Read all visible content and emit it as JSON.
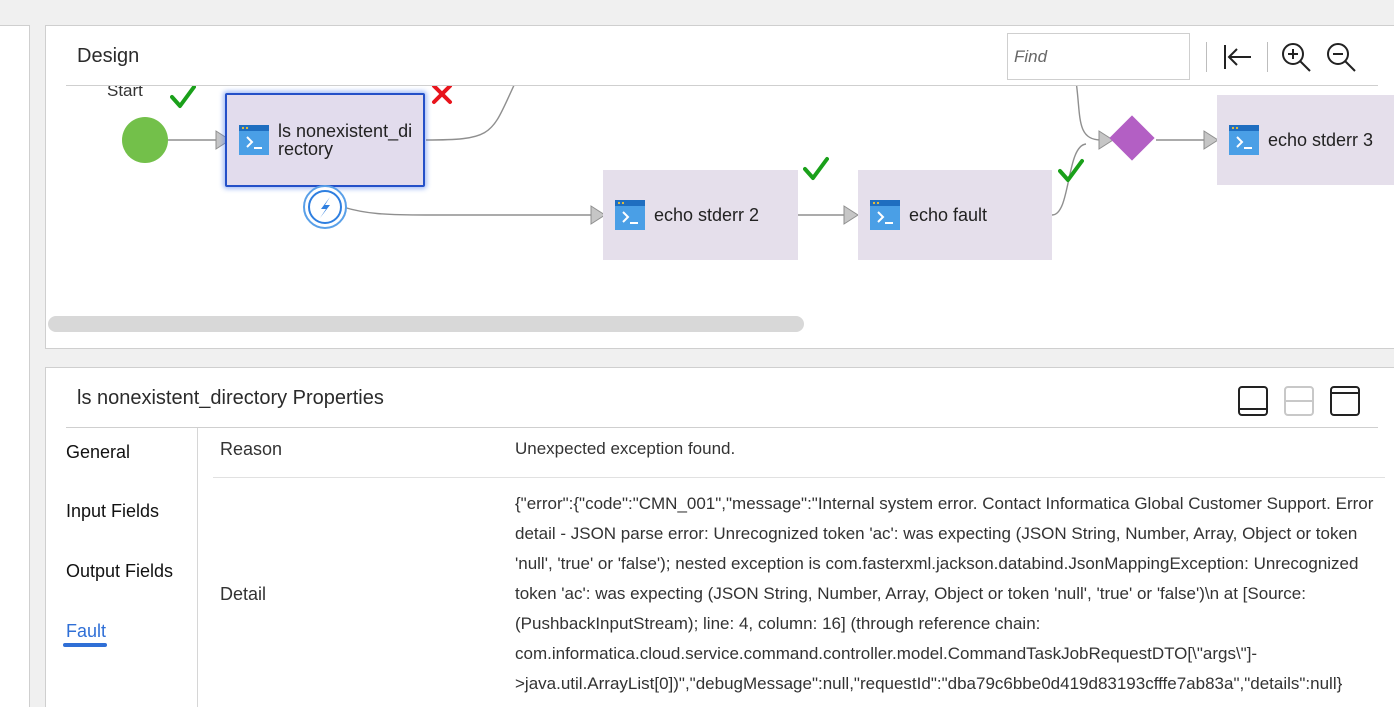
{
  "design": {
    "title": "Design",
    "find_placeholder": "Find",
    "start_label": "Start",
    "nodes": {
      "ls": "ls nonexistent_directory",
      "echo_stderr_2": "echo stderr 2",
      "echo_fault": "echo fault",
      "echo_stderr_3": "echo stderr 3"
    }
  },
  "properties": {
    "title": "ls nonexistent_directory Properties",
    "tabs": [
      "General",
      "Input Fields",
      "Output Fields",
      "Fault"
    ],
    "active_tab": "Fault",
    "reason_label": "Reason",
    "reason_value": "Unexpected exception found.",
    "detail_label": "Detail",
    "detail_value": "{\"error\":{\"code\":\"CMN_001\",\"message\":\"Internal system error. Contact Informatica Global Customer Support. Error detail - JSON parse error: Unrecognized token 'ac': was expecting (JSON String, Number, Array, Object or token 'null', 'true' or 'false'); nested exception is com.fasterxml.jackson.databind.JsonMappingException: Unrecognized token 'ac': was expecting (JSON String, Number, Array, Object or token 'null', 'true' or 'false')\\n at [Source: (PushbackInputStream); line: 4, column: 16] (through reference chain: com.informatica.cloud.service.command.controller.model.CommandTaskJobRequestDTO[\\\"args\\\"]->java.util.ArrayList[0])\",\"debugMessage\":null,\"requestId\":\"dba79c6bbe0d419d83193cfffe7ab83a\",\"details\":null}"
  },
  "colors": {
    "node_fill": "#e5dfeb",
    "start": "#73c04a",
    "gateway": "#b35fc4",
    "selection": "#2450c8",
    "success_check": "#1aa01a",
    "error_x": "#e8141c",
    "active_tab": "#2f6fd6"
  }
}
